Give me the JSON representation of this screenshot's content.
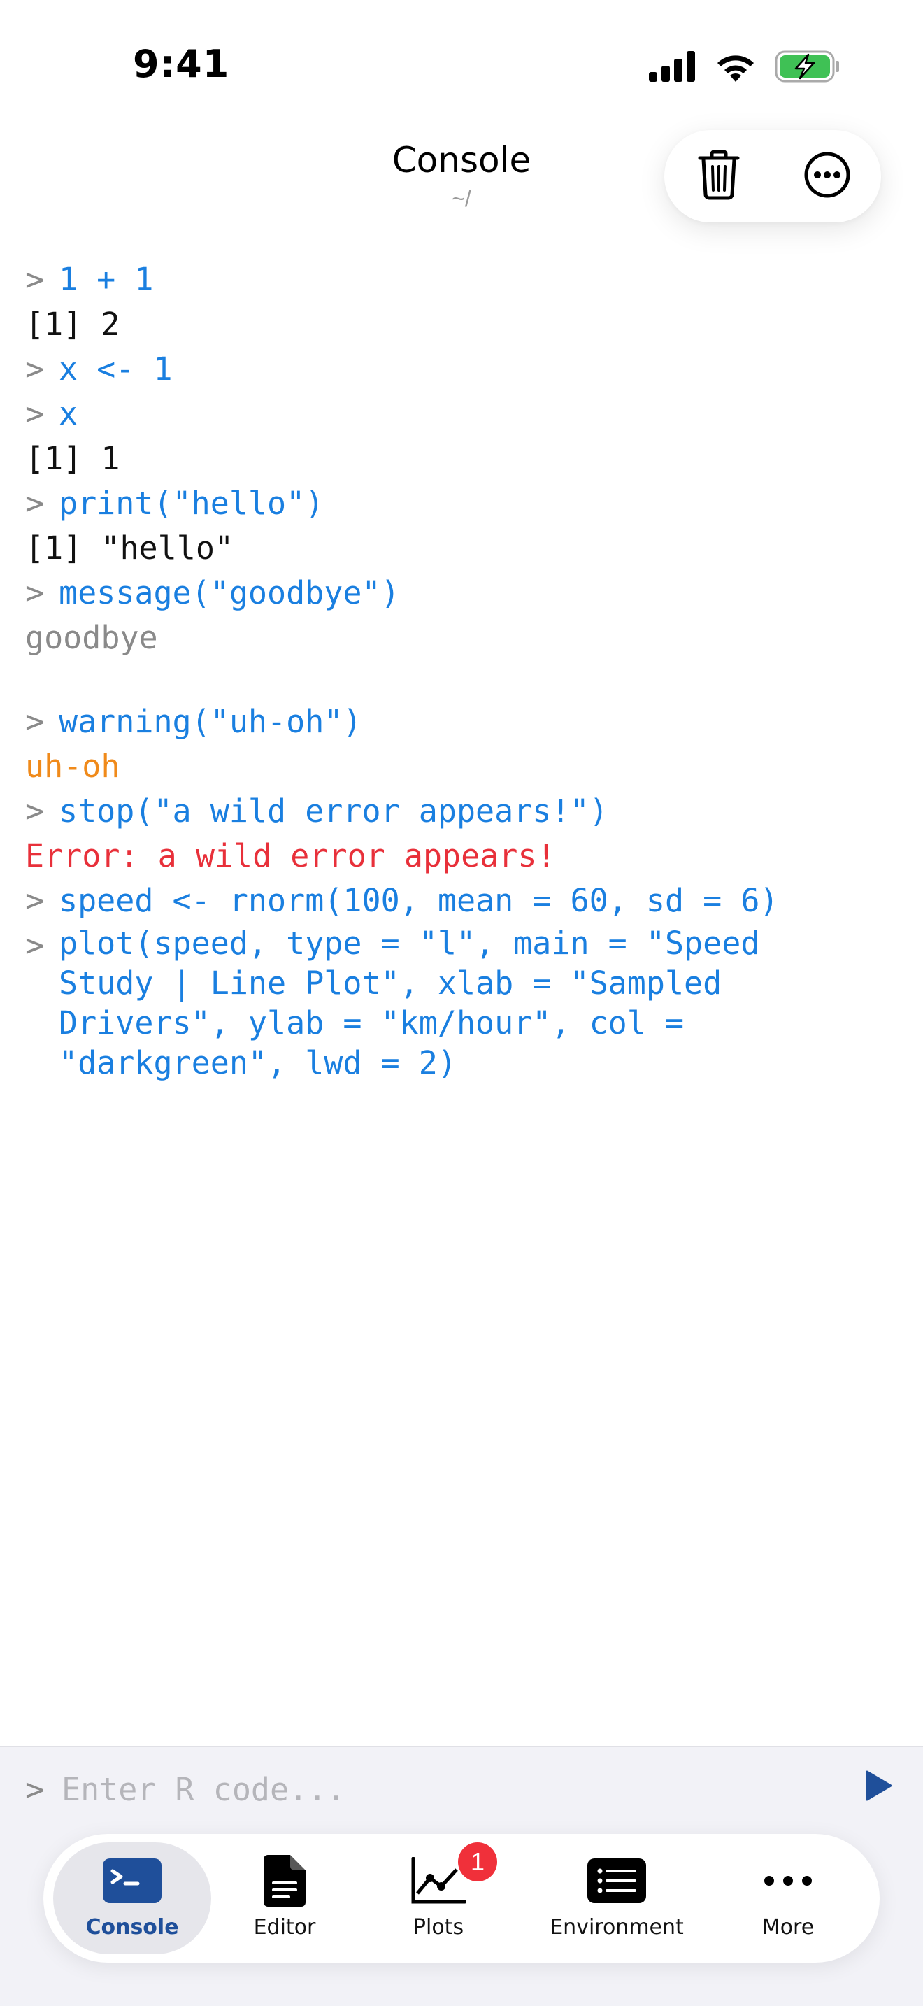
{
  "status_bar": {
    "time": "9:41",
    "icons": [
      "cellular-signal-icon",
      "wifi-icon",
      "battery-charging-icon"
    ]
  },
  "header": {
    "title": "Console",
    "subtitle": "~/",
    "actions": [
      "trash-icon",
      "more-circle-icon"
    ]
  },
  "console": {
    "prompt": ">",
    "lines": [
      {
        "kind": "cmd",
        "text": "1 + 1"
      },
      {
        "kind": "out",
        "text": "[1] 2"
      },
      {
        "kind": "cmd",
        "text": "x <- 1"
      },
      {
        "kind": "cmd",
        "text": "x"
      },
      {
        "kind": "out",
        "text": "[1] 1"
      },
      {
        "kind": "cmd",
        "text": "print(\"hello\")"
      },
      {
        "kind": "out",
        "text": "[1] \"hello\""
      },
      {
        "kind": "cmd",
        "text": "message(\"goodbye\")"
      },
      {
        "kind": "msg",
        "text": "goodbye"
      },
      {
        "kind": "cmd",
        "text": "warning(\"uh-oh\")"
      },
      {
        "kind": "warn",
        "text": "uh-oh"
      },
      {
        "kind": "cmd",
        "text": "stop(\"a wild error appears!\")"
      },
      {
        "kind": "err",
        "text": "Error: a wild error appears!"
      },
      {
        "kind": "cmd",
        "text": "speed <- rnorm(100, mean = 60, sd = 6)"
      },
      {
        "kind": "cmd",
        "text": "plot(speed, type = \"l\", main = \"Speed Study | Line Plot\", xlab = \"Sampled Drivers\", ylab = \"km/hour\", col = \"darkgreen\", lwd = 2)"
      }
    ]
  },
  "input": {
    "prompt": ">",
    "placeholder": "Enter R code...",
    "value": ""
  },
  "tabs": [
    {
      "label": "Console",
      "icon": "terminal-icon",
      "active": true
    },
    {
      "label": "Editor",
      "icon": "document-icon",
      "active": false
    },
    {
      "label": "Plots",
      "icon": "line-chart-icon",
      "active": false,
      "badge": "1"
    },
    {
      "label": "Environment",
      "icon": "list-icon",
      "active": false
    },
    {
      "label": "More",
      "icon": "ellipsis-icon",
      "active": false
    }
  ],
  "colors": {
    "command": "#1a7fe0",
    "output": "#111111",
    "message": "#8a8a8a",
    "warning": "#f08a1a",
    "error": "#e8303a",
    "run_button": "#1f4f9a",
    "badge": "#f0303a"
  }
}
